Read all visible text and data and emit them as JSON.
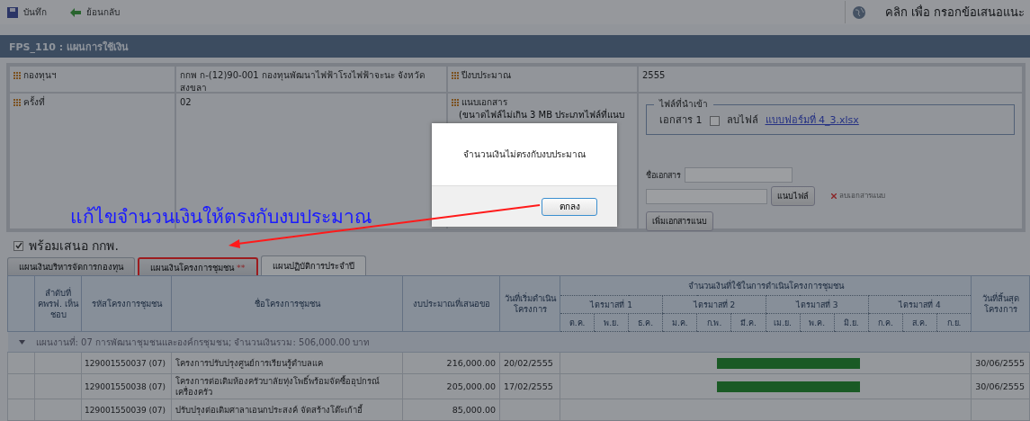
{
  "toolbar": {
    "buttons": [
      {
        "kind": "save",
        "label": "บันทึก"
      },
      {
        "kind": "back",
        "label": "ย้อนกลับ"
      }
    ],
    "feedback": "คลิก เพื่อ กรอกข้อเสนอแนะ"
  },
  "title": "FPS_110 : แผนการใช้เงิน",
  "form": {
    "fund_label": "กองทุนฯ",
    "fund_value": "กกพ ก-(12)90-001 กองทุนพัฒนาไฟฟ้าโรงไฟฟ้าจะนะ จังหวัดสงขลา",
    "year_label": "ปีงบประมาณ",
    "year_value": "2555",
    "round_label": "ครั้งที่",
    "round_value": "02",
    "attach_label": "แนบเอกสาร",
    "attach_note": "(ขนาดไฟล์ไม่เกิน 3 MB ประเภทไฟล์ที่แนบ",
    "imported": {
      "legend": "ไฟล์ที่นำเข้า",
      "items": [
        {
          "label": "เอกสาร 1",
          "delete_label": "ลบไฟล์",
          "delete_checked": false,
          "file": "แบบฟอร์มที่ 4_3.xlsx"
        }
      ]
    },
    "doc_name_label": "ชื่อเอกสาร",
    "attach_button": "แนบไฟล์",
    "remove_label": "ลบเอกสารแนบ",
    "add_button": "เพิ่มเอกสารแนบ"
  },
  "dialog": {
    "message": "จำนวนเงินไม่ตรงกับงบประมาณ",
    "button": "ตกลง"
  },
  "annotation": "แก้ไขจำนวนเงินให้ตรงกับงบประมาณ",
  "ready": {
    "label": "พร้อมเสนอ กกพ.",
    "checked": true
  },
  "tabs": [
    {
      "label": "แผนเงินบริหารจัดการกองทุน",
      "highlighted": false,
      "selected": false
    },
    {
      "label": "แผนเงินโครงการชุมชน",
      "flag": "**",
      "highlighted": true,
      "selected": false
    },
    {
      "label": "แผนปฏิบัติการประจำปี",
      "highlighted": false,
      "selected": true
    }
  ],
  "table": {
    "columns": [
      "ลำดับที่ คพรฟ. เห็นชอบ",
      "รหัสโครงการชุมชน",
      "ชื่อโครงการชุมชน",
      "งบประมาณที่เสนอขอ",
      "วันที่เริ่มดำเนินโครงการ",
      "จำนวนเงินที่ใช้ในการดำเนินโครงการชุมชน",
      "วันที่สิ้นสุดโครงการ"
    ],
    "quarters": [
      "ไตรมาสที่ 1",
      "ไตรมาสที่ 2",
      "ไตรมาสที่ 3",
      "ไตรมาสที่ 4"
    ],
    "months": [
      "ต.ค.",
      "พ.ย.",
      "ธ.ค.",
      "ม.ค.",
      "ก.พ.",
      "มี.ค.",
      "เม.ย.",
      "พ.ค.",
      "มิ.ย.",
      "ก.ค.",
      "ส.ค.",
      "ก.ย."
    ],
    "group": {
      "label": "แผนงานที่: 07 การพัฒนาชุมชนและองค์กรชุมชน; จำนวนเงินรวม: 506,000.00 บาท",
      "expanded": true
    },
    "rows": [
      {
        "code": "129001550037 (07)",
        "name": "โครงการปรับปรุงศูนย์การเรียนรู้ตำบลแค",
        "budget": "216,000.00",
        "start": "20/02/2555",
        "end": "30/06/2555",
        "has_bar": true
      },
      {
        "code": "129001550038 (07)",
        "name": "โครงการต่อเติมห้องครัวบาลัยทุ่งโพธิ์พร้อมจัดซื้ออุปกรณ์เครื่องครัว",
        "budget": "205,000.00",
        "start": "17/02/2555",
        "end": "30/06/2555",
        "has_bar": true
      },
      {
        "code": "129001550039 (07)",
        "name": "ปรับปรุงต่อเติมศาลาเอนกประสงค์ จัดสร้างโต๊ะเก้าอี้",
        "budget": "85,000.00",
        "has_bar": false
      }
    ]
  }
}
